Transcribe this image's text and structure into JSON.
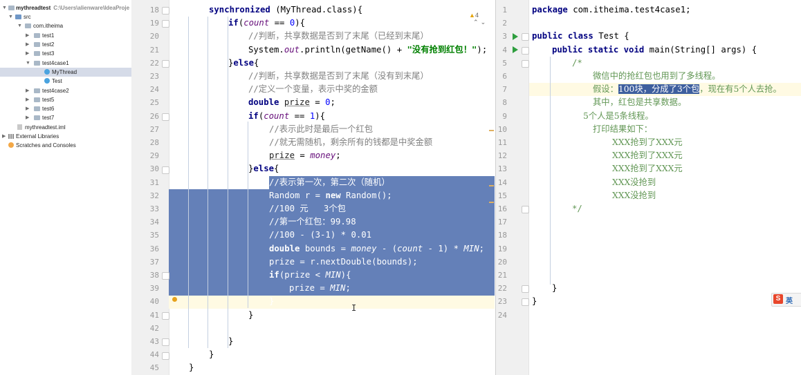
{
  "project": {
    "root": "mythreadtest",
    "root_path": "C:\\Users\\alienware\\IdeaProje",
    "items": [
      {
        "label": "mythreadtest",
        "path": "C:\\Users\\alienware\\IdeaProje"
      },
      {
        "label": "src"
      },
      {
        "label": "com.itheima"
      },
      {
        "label": "test1"
      },
      {
        "label": "test2"
      },
      {
        "label": "test3"
      },
      {
        "label": "test4case1"
      },
      {
        "label": "MyThread"
      },
      {
        "label": "Test"
      },
      {
        "label": "test4case2"
      },
      {
        "label": "test5"
      },
      {
        "label": "test6"
      },
      {
        "label": "test7"
      },
      {
        "label": "mythreadtest.iml"
      },
      {
        "label": "External Libraries"
      },
      {
        "label": "Scratches and Consoles"
      }
    ]
  },
  "left_editor": {
    "warning_count": "4",
    "line_numbers": [
      "18",
      "19",
      "20",
      "21",
      "22",
      "23",
      "24",
      "25",
      "26",
      "27",
      "28",
      "29",
      "30",
      "31",
      "32",
      "33",
      "34",
      "35",
      "36",
      "37",
      "38",
      "39",
      "40",
      "41",
      "42",
      "43",
      "44",
      "45"
    ],
    "t": {
      "l18a": "synchronized",
      "l18b": " (MyThread.class){",
      "l19a": "if",
      "l19b": "(",
      "l19c": "count",
      "l19d": " == ",
      "l19e": "0",
      "l19f": "){",
      "l20": "//判断，共享数据是否到了末尾（已经到末尾）",
      "l21a": "System.",
      "l21b": "out",
      "l21c": ".println(getName() + ",
      "l21d": "\"没有抢到红包！\"",
      "l21e": ");",
      "l22a": "}",
      "l22b": "else",
      "l22c": "{",
      "l23": "//判断，共享数据是否到了末尾（没有到末尾）",
      "l24": "//定义一个变量，表示中奖的金额",
      "l25a": "double",
      "l25b": " ",
      "l25c": "prize",
      "l25d": " = ",
      "l25e": "0",
      "l25f": ";",
      "l26a": "if",
      "l26b": "(",
      "l26c": "count",
      "l26d": " == ",
      "l26e": "1",
      "l26f": "){",
      "l27": "//表示此时是最后一个红包",
      "l28": "//就无需随机，剩余所有的钱都是中奖金额",
      "l29a": "prize",
      "l29b": " = ",
      "l29c": "money",
      "l29d": ";",
      "l30a": "}",
      "l30b": "else",
      "l30c": "{",
      "l31": "//表示第一次，第二次（随机）",
      "l32a": "Random r = ",
      "l32b": "new",
      "l32c": " Random();",
      "l33": "//100 元   3个包",
      "l34": "//第一个红包：99.98",
      "l35": "//100 - (3-1) * 0.01",
      "l36a": "double",
      "l36b": " bounds = ",
      "l36c": "money",
      "l36d": " - (",
      "l36e": "count",
      "l36f": " - 1) * ",
      "l36g": "MIN",
      "l36h": ";",
      "l37": "prize = r.nextDouble(bounds);",
      "l38a": "if",
      "l38b": "(prize < ",
      "l38c": "MIN",
      "l38d": "){",
      "l39a": "prize = ",
      "l39b": "MIN",
      "l39c": ";",
      "l40": "}",
      "l41": "}",
      "l43": "}",
      "l44": "}",
      "l45": "}"
    }
  },
  "right_editor": {
    "line_numbers": [
      "1",
      "2",
      "3",
      "4",
      "5",
      "6",
      "7",
      "8",
      "9",
      "10",
      "11",
      "12",
      "13",
      "14",
      "15",
      "16",
      "17",
      "18",
      "19",
      "20",
      "21",
      "22",
      "23",
      "24"
    ],
    "t": {
      "r1a": "package",
      "r1b": " com.itheima.test4case1;",
      "r3a": "public class",
      "r3b": " Test {",
      "r4a": "public static void",
      "r4b": " main(String[] args) {",
      "r5": "/*",
      "r6": "微信中的抢红包也用到了多线程。",
      "r7a": "假设：",
      "r7b": "100块，分成了3个包",
      "r7c": "，现在有5个人去抢。",
      "r8": "其中，红包是共享数据。",
      "r9": "5个人是5条线程。",
      "r10": "打印结果如下：",
      "r11": "XXX抢到了XXX元",
      "r12": "XXX抢到了XXX元",
      "r13": "XXX抢到了XXX元",
      "r14": "XXX没抢到",
      "r15": "XXX没抢到",
      "r16": "*/",
      "r22": "}",
      "r23": "}"
    }
  },
  "ime": {
    "logo": "S",
    "label": "英"
  },
  "colors": {
    "selection": "#6480b8",
    "keyword": "#000080",
    "string": "#008000",
    "comment": "#808080",
    "javadoc": "#629755",
    "field": "#660e7a"
  }
}
